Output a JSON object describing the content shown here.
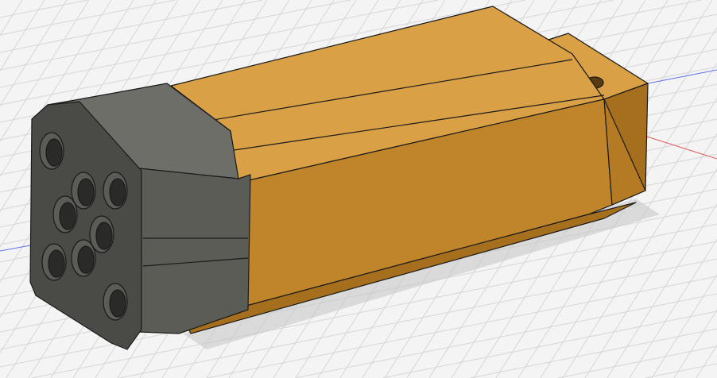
{
  "viewport": {
    "background": "#f4f4f4",
    "grid_line": "#d6d6d6",
    "axis_x": "#e06060",
    "axis_y": "#6070e0"
  },
  "model": {
    "body_color_top": "#d9a046",
    "body_color_front": "#c0852a",
    "body_color_dark": "#a66f1e",
    "connector_front": "#4a4a46",
    "connector_side": "#5c5c57",
    "connector_top": "#6e6e68",
    "hole_color": "#2a2a28",
    "edge_color": "#1a1a1a"
  },
  "icons": [
    "cad-model-icon"
  ]
}
